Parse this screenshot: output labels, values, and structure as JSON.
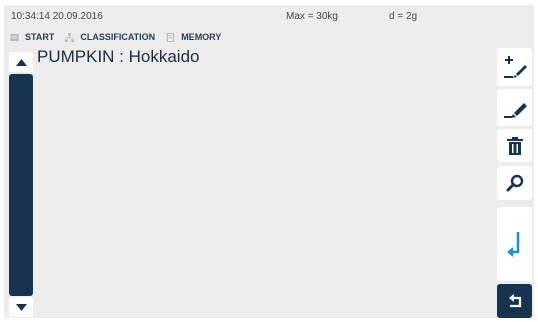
{
  "status_bar": {
    "datetime": "10:34:14 20.09.2016",
    "max_load": "Max = 30kg",
    "division": "d = 2g"
  },
  "breadcrumb": [
    {
      "label": "START",
      "icon": "home-icon"
    },
    {
      "label": "CLASSIFICATION",
      "icon": "sitemap-icon"
    },
    {
      "label": "MEMORY",
      "icon": "memory-icon"
    }
  ],
  "item": {
    "title": "PUMPKIN : Hokkaido"
  },
  "toolbar": [
    {
      "name": "add-button",
      "icon": "add-pen-icon"
    },
    {
      "name": "edit-button",
      "icon": "edit-pen-icon"
    },
    {
      "name": "delete-button",
      "icon": "trash-icon"
    },
    {
      "name": "search-button",
      "icon": "search-icon"
    },
    {
      "name": "enter-button",
      "icon": "enter-arrow-icon"
    },
    {
      "name": "back-button",
      "icon": "back-arrow-icon"
    }
  ],
  "colors": {
    "navy": "#17334f",
    "accent_blue": "#1f8fcf",
    "background": "#ededed"
  }
}
